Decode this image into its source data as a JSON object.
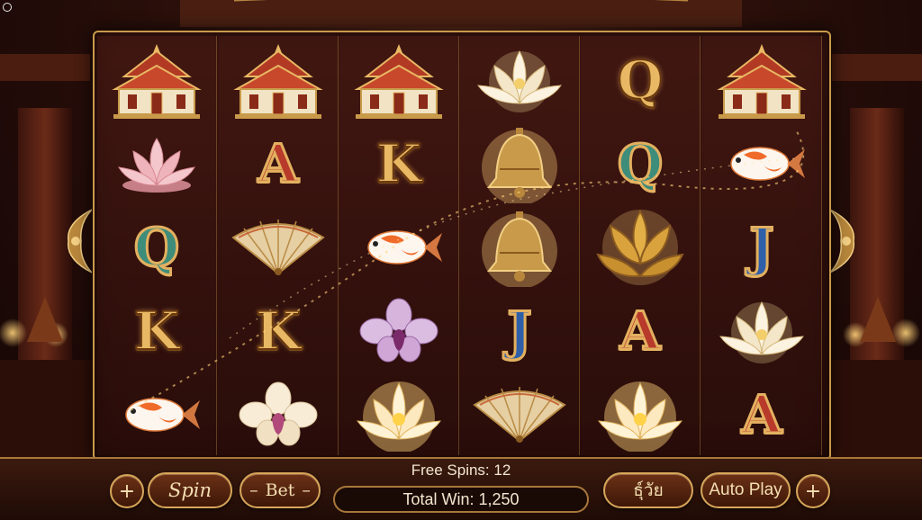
{
  "reels": [
    [
      {
        "symbol": "temple-icon"
      },
      {
        "symbol": "lotus-pink-icon"
      },
      {
        "symbol": "letter",
        "text": "Q",
        "style": "teal"
      },
      {
        "symbol": "letter",
        "text": "K",
        "style": "gold"
      },
      {
        "symbol": "koi-fish-icon"
      }
    ],
    [
      {
        "symbol": "temple-icon"
      },
      {
        "symbol": "letter",
        "text": "A",
        "style": "red"
      },
      {
        "symbol": "fan-icon"
      },
      {
        "symbol": "letter",
        "text": "K",
        "style": "gold"
      },
      {
        "symbol": "orchid-white-icon"
      }
    ],
    [
      {
        "symbol": "temple-icon"
      },
      {
        "symbol": "letter",
        "text": "K",
        "style": "gold"
      },
      {
        "symbol": "koi-fish-icon"
      },
      {
        "symbol": "orchid-purple-icon"
      },
      {
        "symbol": "lotus-gold-icon"
      }
    ],
    [
      {
        "symbol": "lotus-white-icon"
      },
      {
        "symbol": "bell-icon"
      },
      {
        "symbol": "bell-icon"
      },
      {
        "symbol": "letter",
        "text": "J",
        "style": "blue"
      },
      {
        "symbol": "fan-icon"
      }
    ],
    [
      {
        "symbol": "letter",
        "text": "Q",
        "style": "gold"
      },
      {
        "symbol": "letter",
        "text": "Q",
        "style": "teal"
      },
      {
        "symbol": "golden-lotus-wild-icon"
      },
      {
        "symbol": "letter",
        "text": "A",
        "style": "red"
      },
      {
        "symbol": "lotus-gold-icon"
      }
    ],
    [
      {
        "symbol": "temple-icon"
      },
      {
        "symbol": "koi-fish-icon"
      },
      {
        "symbol": "letter",
        "text": "J",
        "style": "blue"
      },
      {
        "symbol": "lotus-white-icon"
      },
      {
        "symbol": "letter",
        "text": "A",
        "style": "red"
      }
    ]
  ],
  "controls": {
    "minus_left": "+",
    "spin_label": "Spin",
    "bet_label": "Bet",
    "free_spins": "Free Spins: 12",
    "total_win": "Total Win: 1,250",
    "thai_label": "ธุ์วัย",
    "auto_play_label": "Auto Play",
    "plus_right": "+"
  },
  "colors": {
    "frame_gold": "#c89a4a",
    "button_fill": "#6b3116",
    "text_cream": "#f5dfb2"
  }
}
